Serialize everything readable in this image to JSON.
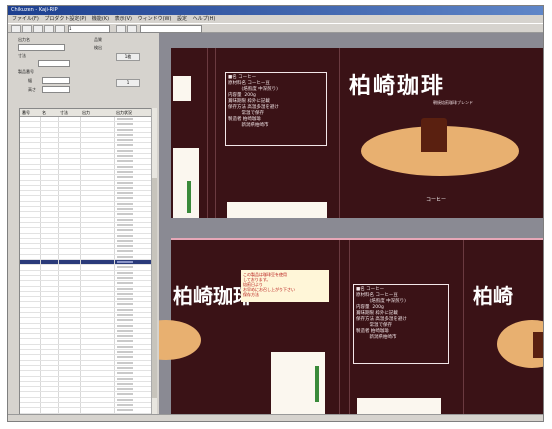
{
  "window": {
    "title": "Chikuzen - Kaji-RIP",
    "menu": [
      "ファイル(F)",
      "プロダクト設定(P)",
      "機能(K)",
      "表示(V)",
      "ウィンドウ(W)",
      "設定",
      "ヘルプ(H)"
    ],
    "toolbar_value": "1"
  },
  "form": {
    "label_a": "出力名",
    "label_b": "寸法",
    "label_c": "製品番号",
    "label_d": "幅",
    "label_e": "高さ",
    "label_f": "品質",
    "label_g": "検出",
    "button_a": "1枚",
    "button_b": "1"
  },
  "table": {
    "headers": [
      "番号",
      "名",
      "寸法",
      "出力",
      "出力状況"
    ],
    "row_count": 58,
    "selected_row_index": 27
  },
  "artwork": {
    "brand_text": "柏崎珈琲",
    "brand_subtitle": "朝焼焙煎珈琲ブレンド",
    "product_label": "コーヒー",
    "info_title": "■名 コーヒー",
    "info_lines": [
      "原材料名 コーヒー豆",
      "　　　(焙煎度 中深煎り)",
      "内容量  200g",
      "賞味期限 枠外に記載",
      "保存方法 高温多湿を避け",
      "　　　常温で保存",
      "製造者 柏崎珈琲",
      "　　　新潟県柏崎市"
    ],
    "note_lines": [
      "この製品は珈琲豆を使用",
      "しております。",
      "焙煎日より",
      "お早めにお召し上がり下さい",
      "保存方法"
    ],
    "colors": {
      "panel_bg": "#3a1216",
      "accent": "#e8b070",
      "workspace": "#8a8a93"
    }
  }
}
